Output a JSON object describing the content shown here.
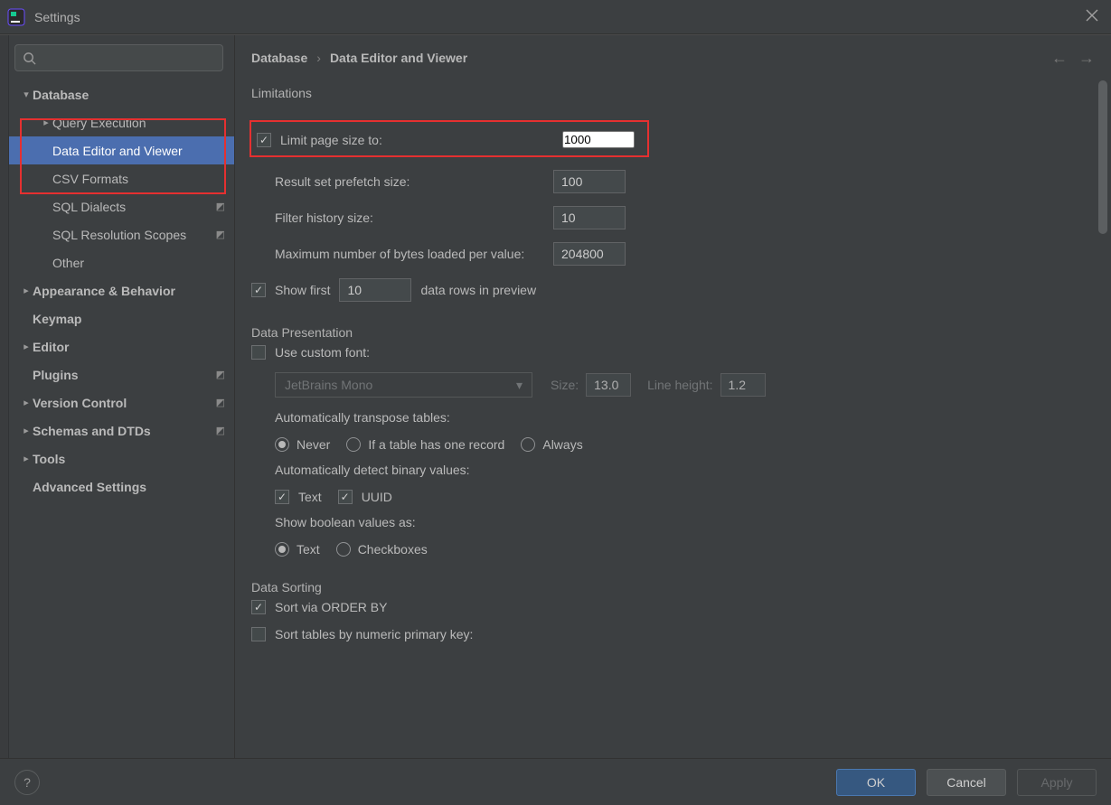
{
  "window": {
    "title": "Settings"
  },
  "sidebar": {
    "search_placeholder": "",
    "items": [
      {
        "label": "Database",
        "bold": true,
        "chev": "down",
        "indent": 0
      },
      {
        "label": "Query Execution",
        "chev": "right",
        "indent": 1
      },
      {
        "label": "Data Editor and Viewer",
        "indent": 1,
        "selected": true
      },
      {
        "label": "CSV Formats",
        "indent": 1
      },
      {
        "label": "SQL Dialects",
        "indent": 1,
        "badge": "◩"
      },
      {
        "label": "SQL Resolution Scopes",
        "indent": 1,
        "badge": "◩"
      },
      {
        "label": "Other",
        "indent": 1
      },
      {
        "label": "Appearance & Behavior",
        "bold": true,
        "chev": "right",
        "indent": 0
      },
      {
        "label": "Keymap",
        "bold": true,
        "indent": 0
      },
      {
        "label": "Editor",
        "bold": true,
        "chev": "right",
        "indent": 0
      },
      {
        "label": "Plugins",
        "bold": true,
        "indent": 0,
        "badge": "◩"
      },
      {
        "label": "Version Control",
        "bold": true,
        "chev": "right",
        "indent": 0,
        "badge": "◩"
      },
      {
        "label": "Schemas and DTDs",
        "bold": true,
        "chev": "right",
        "indent": 0,
        "badge": "◩"
      },
      {
        "label": "Tools",
        "bold": true,
        "chev": "right",
        "indent": 0
      },
      {
        "label": "Advanced Settings",
        "bold": true,
        "indent": 0
      }
    ]
  },
  "breadcrumb": {
    "a": "Database",
    "b": "Data Editor and Viewer"
  },
  "limitations": {
    "title": "Limitations",
    "limit_page_label": "Limit page size to:",
    "limit_page_value": "1000",
    "prefetch_label": "Result set prefetch size:",
    "prefetch_value": "100",
    "filter_hist_label": "Filter history size:",
    "filter_hist_value": "10",
    "max_bytes_label": "Maximum number of bytes loaded per value:",
    "max_bytes_value": "204800",
    "show_first_pre": "Show first",
    "show_first_value": "10",
    "show_first_post": "data rows in preview"
  },
  "presentation": {
    "title": "Data Presentation",
    "use_custom_font": "Use custom font:",
    "font_name": "JetBrains Mono",
    "size_label": "Size:",
    "size_value": "13.0",
    "lineh_label": "Line height:",
    "lineh_value": "1.2",
    "transpose_label": "Automatically transpose tables:",
    "transpose_opts": [
      "Never",
      "If a table has one record",
      "Always"
    ],
    "binary_label": "Automatically detect binary values:",
    "binary_opts": [
      "Text",
      "UUID"
    ],
    "bool_label": "Show boolean values as:",
    "bool_opts": [
      "Text",
      "Checkboxes"
    ]
  },
  "sorting": {
    "title": "Data Sorting",
    "order_by": "Sort via ORDER BY",
    "sort_pk": "Sort tables by numeric primary key:"
  },
  "footer": {
    "ok": "OK",
    "cancel": "Cancel",
    "apply": "Apply"
  }
}
